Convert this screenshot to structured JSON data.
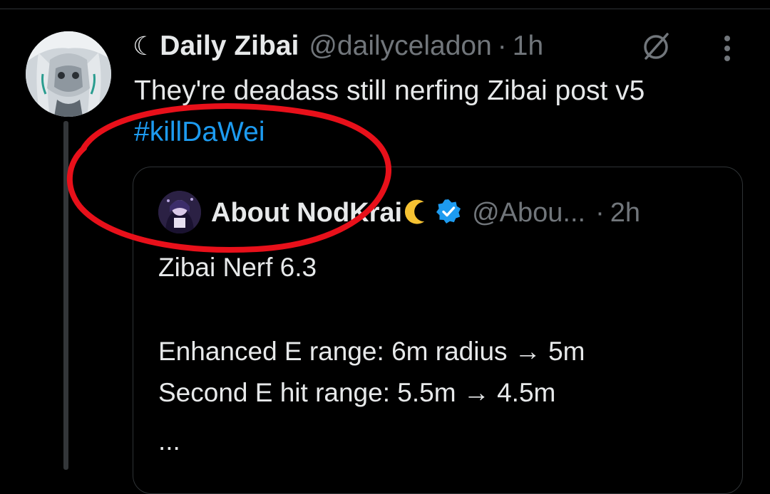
{
  "tweet": {
    "author": {
      "prefix_glyph": "☾",
      "display_name": "Daily Zibai",
      "handle": "@dailyceladon",
      "separator": "·",
      "time": "1h"
    },
    "text": "They're deadass still nerfing Zibai post v5",
    "hashtag": "#killDaWei"
  },
  "quoted_tweet": {
    "author": {
      "display_name": "About NodKrai",
      "handle": "@Abou...",
      "separator": "·",
      "time": "2h"
    },
    "lines": [
      "Zibai Nerf 6.3",
      "Enhanced E range: 6m radius → 5m",
      "Second E hit range: 5.5m → 4.5m",
      "..."
    ]
  },
  "colors": {
    "background": "#000000",
    "text_primary": "#e7e9ea",
    "text_secondary": "#71767b",
    "link": "#1d9bf0",
    "verified": "#1d9bf0",
    "annotation": "#e8101a",
    "moon_emoji": "#f6c232"
  },
  "icons": {
    "grok": "grok-icon",
    "more": "more-vertical-icon",
    "verified": "verified-badge-icon",
    "moon": "crescent-moon-icon"
  }
}
